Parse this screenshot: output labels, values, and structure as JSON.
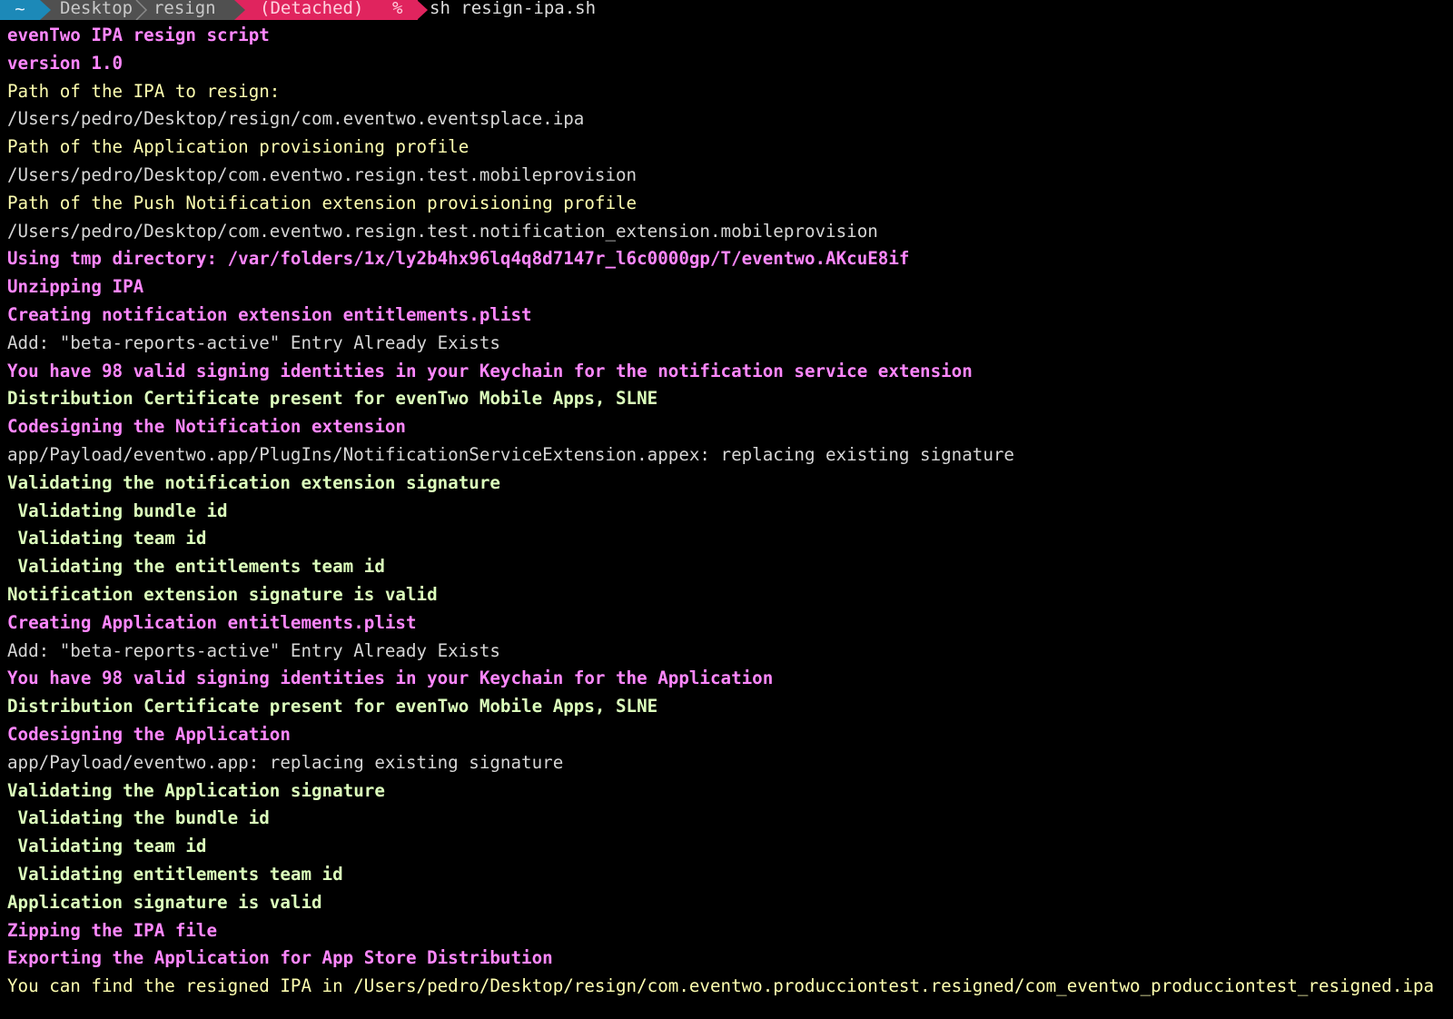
{
  "prompt": {
    "home": "~",
    "dirs": "Desktop  resign",
    "branch": "(Detached)",
    "symbol": "%",
    "command": "sh resign-ipa.sh"
  },
  "colors": {
    "home_segment": "#1c89b8",
    "path_segment": "#505050",
    "git_segment": "#e0245e",
    "pink": "#ff87ff",
    "yellow": "#ffffb0",
    "white": "#d6d6d6",
    "green": "#dcffbc"
  },
  "output": {
    "lines": [
      {
        "text": "evenTwo IPA resign script",
        "color": "pink"
      },
      {
        "text": "version 1.0",
        "color": "pink"
      },
      {
        "text": "Path of the IPA to resign:",
        "color": "yellow"
      },
      {
        "text": "/Users/pedro/Desktop/resign/com.eventwo.eventsplace.ipa",
        "color": "white"
      },
      {
        "text": "Path of the Application provisioning profile",
        "color": "yellow"
      },
      {
        "text": "/Users/pedro/Desktop/com.eventwo.resign.test.mobileprovision",
        "color": "white"
      },
      {
        "text": "Path of the Push Notification extension provisioning profile",
        "color": "yellow"
      },
      {
        "text": "/Users/pedro/Desktop/com.eventwo.resign.test.notification_extension.mobileprovision",
        "color": "white"
      },
      {
        "text": "Using tmp directory: /var/folders/1x/ly2b4hx96lq4q8d7147r_l6c0000gp/T/eventwo.AKcuE8if",
        "color": "pink"
      },
      {
        "text": "Unzipping IPA",
        "color": "pink"
      },
      {
        "text": "Creating notification extension entitlements.plist",
        "color": "pink"
      },
      {
        "text": "Add: \"beta-reports-active\" Entry Already Exists",
        "color": "white"
      },
      {
        "text": "You have 98 valid signing identities in your Keychain for the notification service extension",
        "color": "pink"
      },
      {
        "text": "Distribution Certificate present for evenTwo Mobile Apps, SLNE",
        "color": "green"
      },
      {
        "text": "Codesigning the Notification extension",
        "color": "pink"
      },
      {
        "text": "app/Payload/eventwo.app/PlugIns/NotificationServiceExtension.appex: replacing existing signature",
        "color": "white"
      },
      {
        "text": "Validating the notification extension signature",
        "color": "green"
      },
      {
        "text": " Validating bundle id",
        "color": "green"
      },
      {
        "text": " Validating team id",
        "color": "green"
      },
      {
        "text": " Validating the entitlements team id",
        "color": "green"
      },
      {
        "text": "Notification extension signature is valid",
        "color": "green"
      },
      {
        "text": "Creating Application entitlements.plist",
        "color": "pink"
      },
      {
        "text": "Add: \"beta-reports-active\" Entry Already Exists",
        "color": "white"
      },
      {
        "text": "You have 98 valid signing identities in your Keychain for the Application",
        "color": "pink"
      },
      {
        "text": "Distribution Certificate present for evenTwo Mobile Apps, SLNE",
        "color": "green"
      },
      {
        "text": "Codesigning the Application",
        "color": "pink"
      },
      {
        "text": "app/Payload/eventwo.app: replacing existing signature",
        "color": "white"
      },
      {
        "text": "Validating the Application signature",
        "color": "green"
      },
      {
        "text": " Validating the bundle id",
        "color": "green"
      },
      {
        "text": " Validating team id",
        "color": "green"
      },
      {
        "text": " Validating entitlements team id",
        "color": "green"
      },
      {
        "text": "Application signature is valid",
        "color": "green"
      },
      {
        "text": "Zipping the IPA file",
        "color": "pink"
      },
      {
        "text": "Exporting the Application for App Store Distribution",
        "color": "pink"
      },
      {
        "text": "You can find the resigned IPA in /Users/pedro/Desktop/resign/com.eventwo.producciontest.resigned/com_eventwo_producciontest_resigned.ipa",
        "color": "yellow"
      }
    ]
  }
}
